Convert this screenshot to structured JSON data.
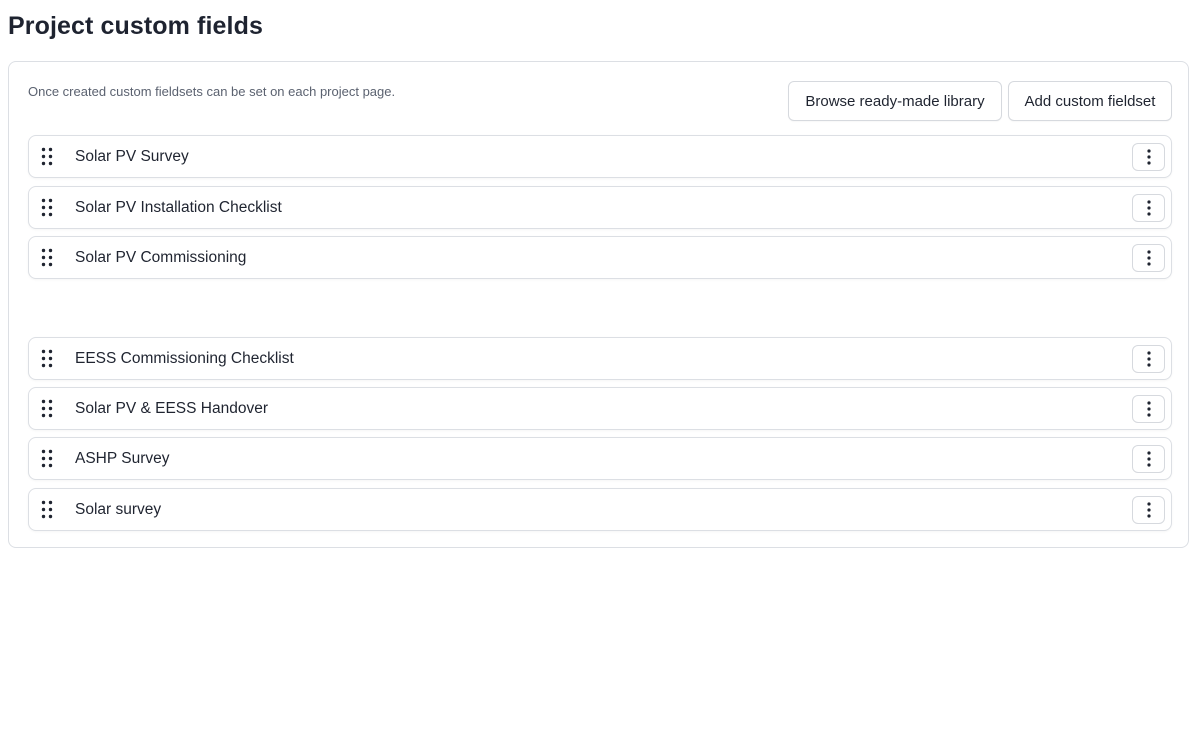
{
  "page": {
    "title": "Project custom fields"
  },
  "panel": {
    "hint": "Once created custom fieldsets can be set on each project page.",
    "browse_label": "Browse ready-made library",
    "add_label": "Add custom fieldset"
  },
  "fieldsets": [
    {
      "label": "Solar PV Survey"
    },
    {
      "label": "Solar PV Installation Checklist"
    },
    {
      "label": "Solar PV Commissioning"
    },
    {
      "label": "EESS Commissioning Checklist"
    },
    {
      "label": "Solar PV & EESS Handover"
    },
    {
      "label": "ASHP Survey"
    },
    {
      "label": "Solar survey"
    }
  ],
  "icons": {
    "drag": "drag-handle-icon",
    "menu": "more-vertical-icon"
  },
  "colors": {
    "border": "#dcdfe4",
    "text": "#1f2430",
    "muted": "#5b6270"
  }
}
